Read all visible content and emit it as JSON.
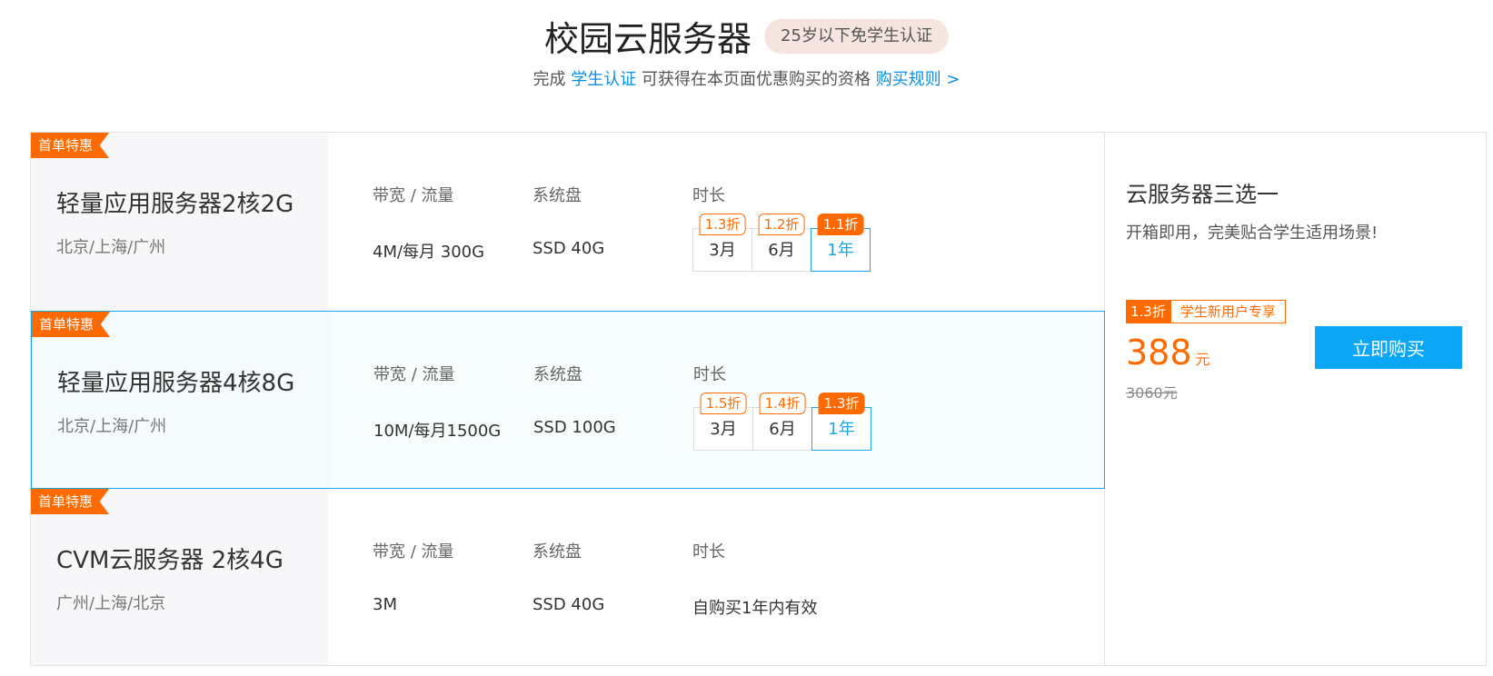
{
  "header": {
    "title": "校园云服务器",
    "badge": "25岁以下免学生认证",
    "subtitle_prefix": "完成 ",
    "subtitle_link1": "学生认证",
    "subtitle_middle": " 可获得在本页面优惠购买的资格 ",
    "subtitle_link2": "购买规则 >"
  },
  "labels": {
    "bandwidth": "带宽 / 流量",
    "disk": "系统盘",
    "duration": "时长"
  },
  "products": [
    {
      "tag": "首单特惠",
      "name": "轻量应用服务器2核2G",
      "region": "北京/上海/广州",
      "bandwidth": "4M/每月 300G",
      "disk": "SSD 40G",
      "durations": [
        {
          "label": "3月",
          "discount": "1.3折"
        },
        {
          "label": "6月",
          "discount": "1.2折"
        },
        {
          "label": "1年",
          "discount": "1.1折"
        }
      ]
    },
    {
      "tag": "首单特惠",
      "name": "轻量应用服务器4核8G",
      "region": "北京/上海/广州",
      "bandwidth": "10M/每月1500G",
      "disk": "SSD 100G",
      "durations": [
        {
          "label": "3月",
          "discount": "1.5折"
        },
        {
          "label": "6月",
          "discount": "1.4折"
        },
        {
          "label": "1年",
          "discount": "1.3折"
        }
      ]
    },
    {
      "tag": "首单特惠",
      "name": "CVM云服务器 2核4G",
      "region": "广州/上海/北京",
      "bandwidth": "3M",
      "disk": "SSD 40G",
      "duration_text": "自购买1年内有效"
    }
  ],
  "side": {
    "title": "云服务器三选一",
    "desc": "开箱即用，完美贴合学生适用场景!",
    "promo_discount": "1.3折",
    "promo_text": "学生新用户专享",
    "price": "388",
    "unit": "元",
    "original_price": "3060元",
    "buy_label": "立即购买"
  },
  "colors": {
    "accent_orange": "#ff6a00",
    "accent_blue": "#17a7e6",
    "buy_button": "#0ba6f5"
  }
}
